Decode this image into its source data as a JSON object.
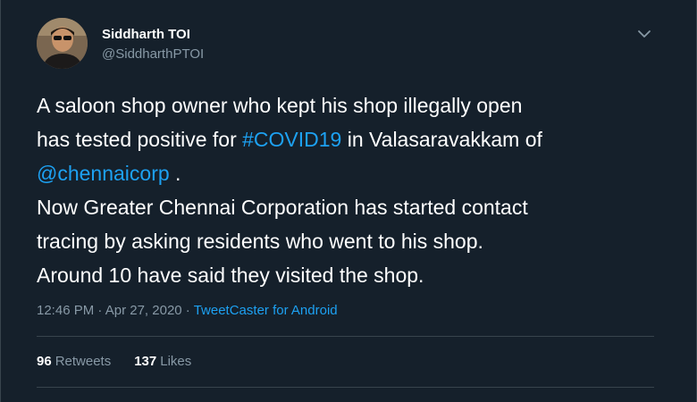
{
  "author": {
    "name": "Siddharth TOI",
    "handle": "@SiddharthPTOI"
  },
  "tweet": {
    "line1": "A saloon shop owner who kept his shop illegally open",
    "line2_prefix": "has tested positive for ",
    "hashtag": "#COVID19",
    "line2_suffix": " in Valasaravakkam of",
    "mention": "@chennaicorp",
    "line3_suffix": " .",
    "line4": "Now Greater Chennai Corporation has started contact",
    "line5": "tracing by asking residents who went to his shop.",
    "line6": "Around 10 have said they visited the shop."
  },
  "meta": {
    "time": "12:46 PM",
    "separator": " · ",
    "date": "Apr 27, 2020",
    "source": "TweetCaster for Android"
  },
  "stats": {
    "retweets_count": "96",
    "retweets_label": "Retweets",
    "likes_count": "137",
    "likes_label": "Likes"
  },
  "colors": {
    "background": "#15202b",
    "link": "#1da1f2",
    "secondary_text": "#8899a6",
    "divider": "#38444d"
  },
  "icons": {
    "caret": "chevron-down-icon"
  }
}
